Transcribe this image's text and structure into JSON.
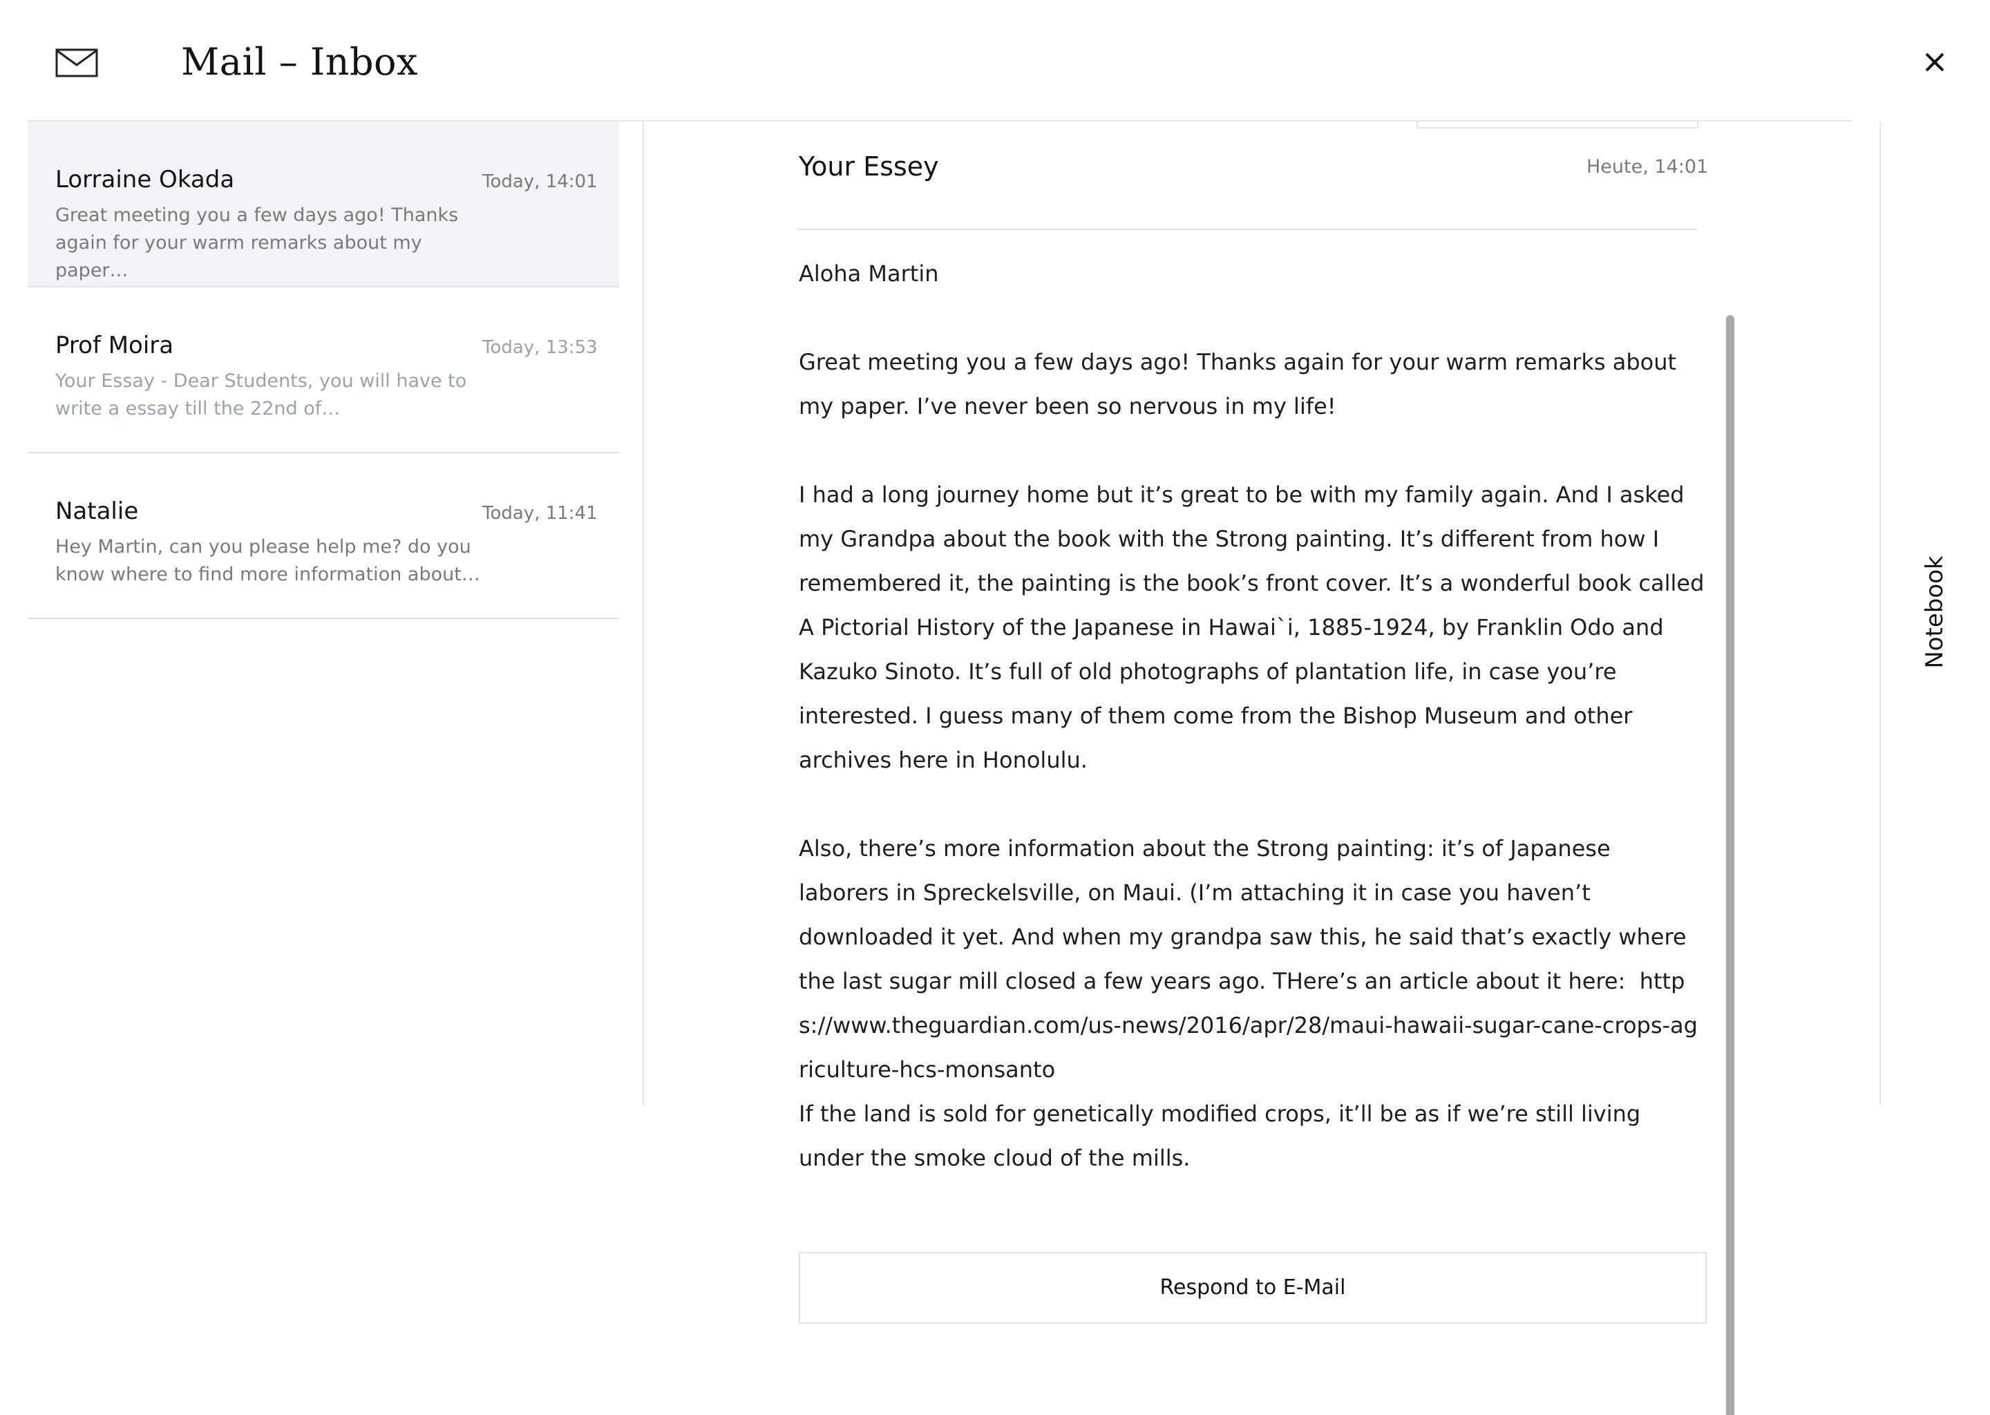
{
  "header": {
    "title": "Mail – Inbox",
    "icon": "mail-icon",
    "close_icon": "close-icon"
  },
  "inbox": {
    "items": [
      {
        "sender": "Lorraine Okada",
        "time": "Today, 14:01",
        "preview": "Great meeting you a few days ago! Thanks again for your warm remarks about my paper…",
        "selected": true
      },
      {
        "sender": "Prof Moira",
        "time": "Today, 13:53",
        "preview": "Your Essay - Dear Students, you will have to write a essay till the 22nd of…",
        "selected": false
      },
      {
        "sender": "Natalie",
        "time": "Today, 11:41",
        "preview": "Hey Martin, can you please help me? do you know where to find more information about…",
        "selected": false
      }
    ]
  },
  "message": {
    "subject": "Your Essey",
    "date": "Heute, 14:01",
    "greeting": "Aloha Martin",
    "paragraphs": [
      "Great meeting you a few days ago! Thanks again for your warm remarks about my paper. I’ve never been so nervous in my life!",
      "I had a long journey home but it’s great to be with my family again. And I asked my Grandpa about the book with the Strong painting. It’s different from how I remembered it, the painting is the book’s front cover. It’s a wonderful book called A Pictorial History of the Japanese in Hawai`i, 1885-1924, by Franklin Odo and Kazuko Sinoto. It’s full of old photographs of plantation life, in case you’re interested. I guess many of them come from the Bishop Museum and other archives here in Honolulu.",
      "Also, there’s more information about the Strong painting: it’s of Japanese laborers in Spreckelsville, on Maui. (I’m attaching it in case you haven’t downloaded it yet. And when my grandpa saw this, he said that’s exactly where the last sugar mill closed a few years ago. THere’s an article about it here:",
      "If the land is sold for genetically modified crops, it’ll be as if we’re still living under the smoke cloud of the mills."
    ],
    "link": "https://www.theguardian.com/us-news/2016/apr/28/maui-hawaii-sugar-cane-crops-agriculture-hcs-monsanto",
    "respond_label": "Respond to E-Mail"
  },
  "notebook": {
    "label": "Notebook"
  },
  "colors": {
    "selected_row": "#f2f3f5",
    "divider": "#e2e2e2",
    "muted_text": "#7a7a7a",
    "scrollbar": "#a9a9a9"
  }
}
